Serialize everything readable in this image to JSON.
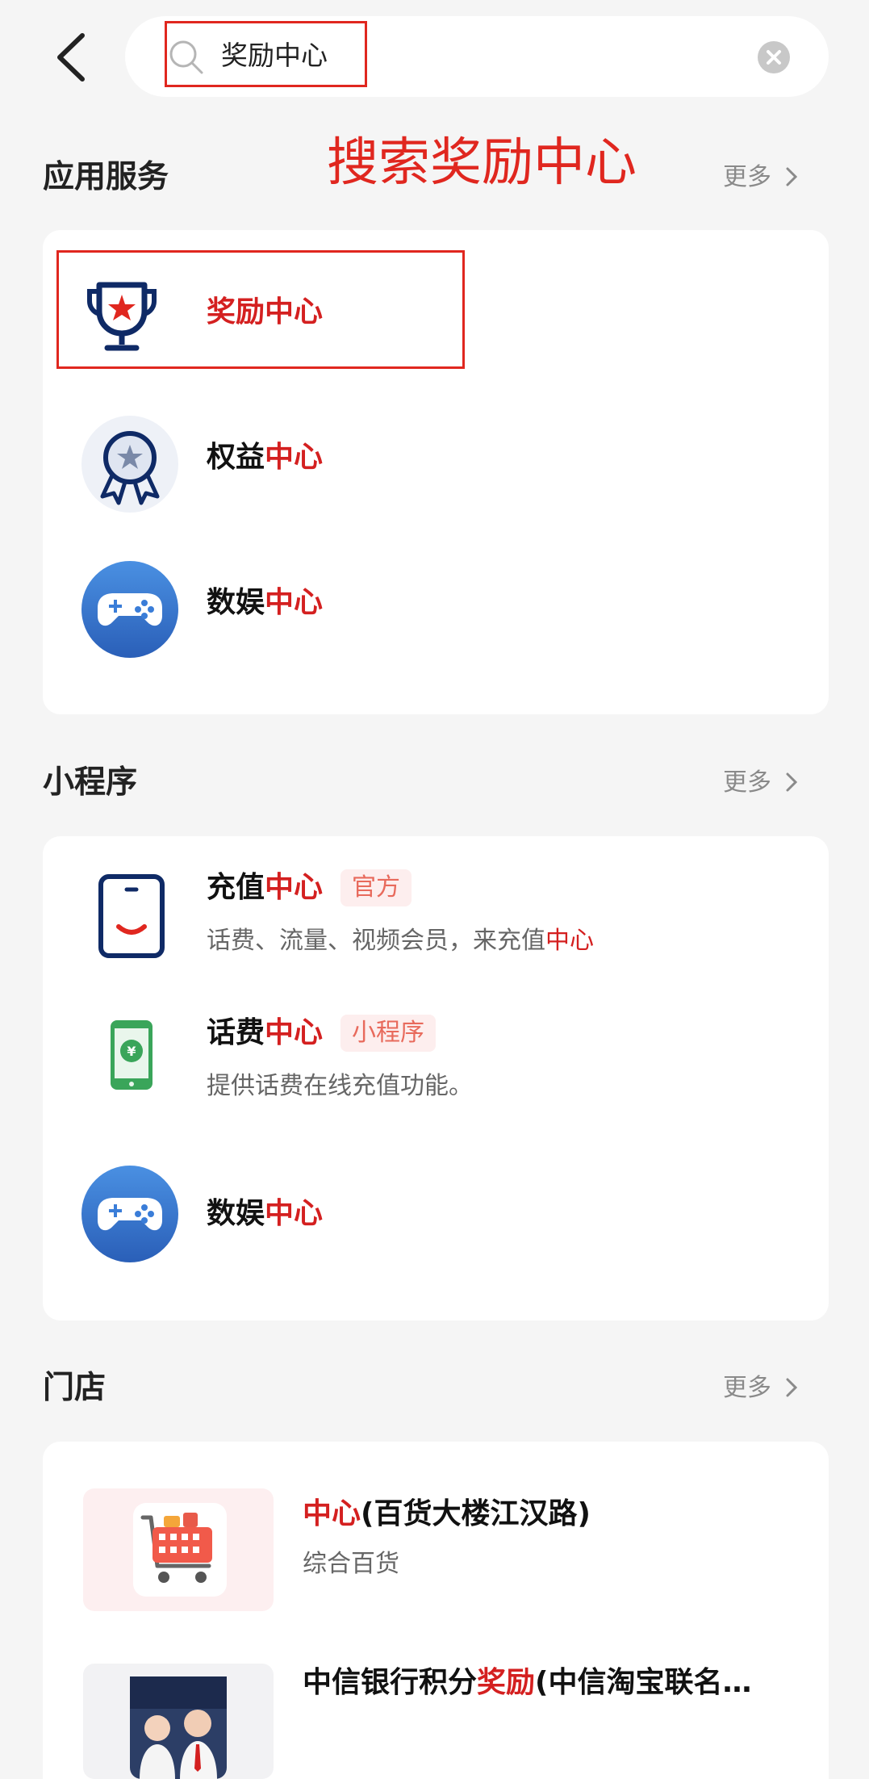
{
  "search": {
    "query": "奖励中心",
    "annotation": "搜索奖励中心"
  },
  "sections": {
    "app_services": {
      "title": "应用服务",
      "more": "更多",
      "items": [
        {
          "prefix": "奖励中心",
          "hl": "",
          "icon": "trophy-icon"
        },
        {
          "prefix": "权益",
          "hl": "中心",
          "icon": "badge-icon"
        },
        {
          "prefix": "数娱",
          "hl": "中心",
          "icon": "gamepad-icon"
        }
      ]
    },
    "mini_programs": {
      "title": "小程序",
      "more": "更多",
      "items": [
        {
          "prefix": "充值",
          "hl": "中心",
          "tag": "官方",
          "desc_prefix": "话费、流量、视频会员，来充值",
          "desc_hl": "中心",
          "icon": "phone-icon"
        },
        {
          "prefix": "话费",
          "hl": "中心",
          "tag": "小程序",
          "desc_prefix": "提供话费在线充值功能。",
          "desc_hl": "",
          "icon": "yuan-phone-icon"
        },
        {
          "prefix": "数娱",
          "hl": "中心",
          "icon": "gamepad-icon"
        }
      ]
    },
    "stores": {
      "title": "门店",
      "more": "更多",
      "items": [
        {
          "hl": "中心",
          "suffix": "(百货大楼江汉路)",
          "sub": "综合百货",
          "icon": "shopping-cart-icon"
        },
        {
          "prefix": "中信银行积分",
          "hl": "奖励",
          "suffix": "(中信淘宝联名…",
          "icon": "people-thumbnail"
        }
      ]
    }
  },
  "colors": {
    "accent": "#d42020",
    "annotation_red": "#e0271f",
    "background": "#f5f5f5",
    "card": "#ffffff",
    "icon_navy": "#0f2a66",
    "gamepad_blue": "#3a7dd8"
  }
}
